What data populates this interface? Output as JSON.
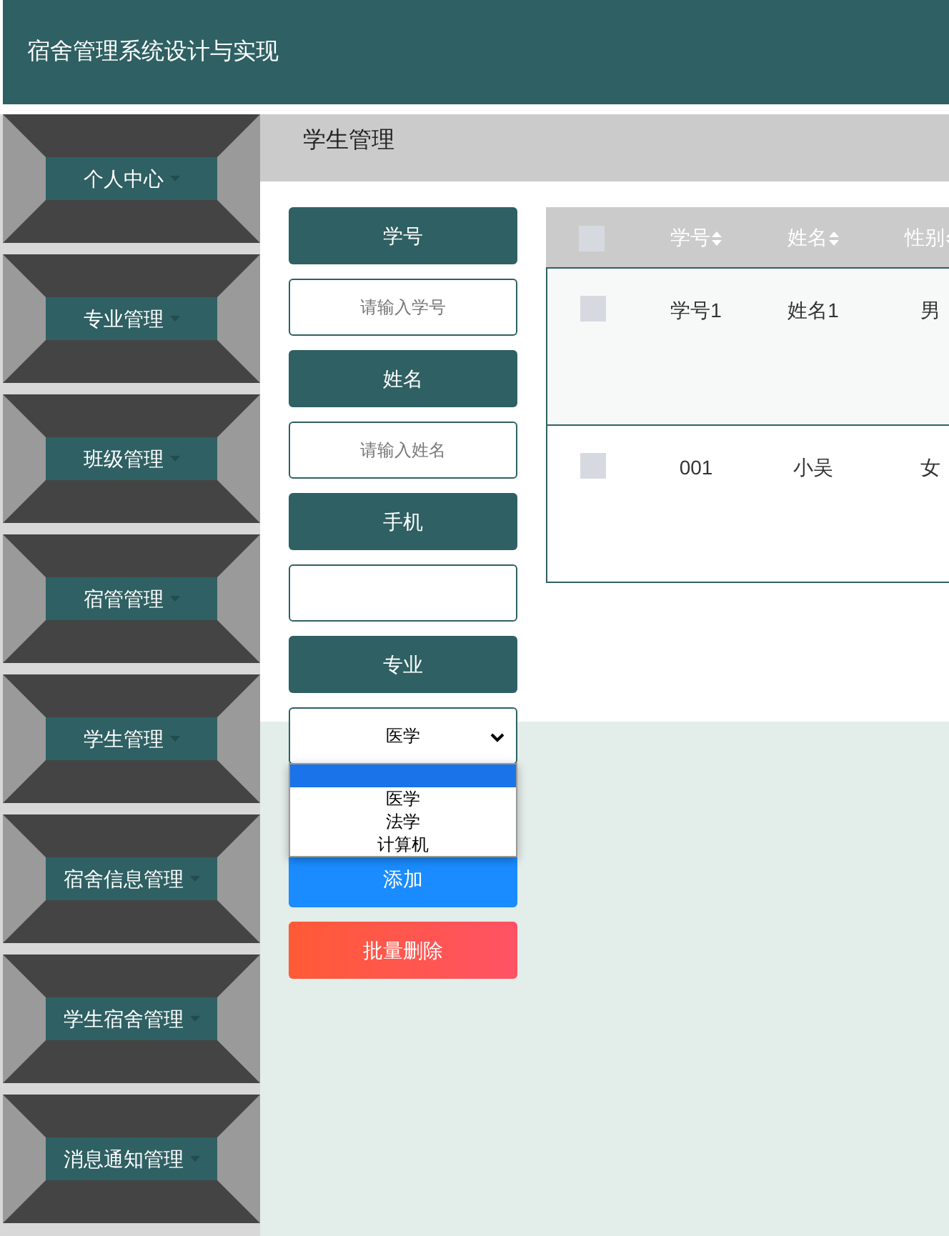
{
  "header": {
    "title": "宿舍管理系统设计与实现"
  },
  "sidebar": {
    "items": [
      {
        "label": "个人中心"
      },
      {
        "label": "专业管理"
      },
      {
        "label": "班级管理"
      },
      {
        "label": "宿管管理"
      },
      {
        "label": "学生管理"
      },
      {
        "label": "宿舍信息管理"
      },
      {
        "label": "学生宿舍管理"
      },
      {
        "label": "消息通知管理"
      }
    ]
  },
  "page_title": "学生管理",
  "form": {
    "fields": [
      {
        "label": "学号",
        "kind": "input",
        "placeholder": "请输入学号"
      },
      {
        "label": "姓名",
        "kind": "input",
        "placeholder": "请输入姓名"
      },
      {
        "label": "手机",
        "kind": "input"
      },
      {
        "label": "专业",
        "kind": "select",
        "value": "医学",
        "options": [
          {
            "highlighted": true
          },
          {
            "label": "医学",
            "highlighted": false
          },
          {
            "label": "法学",
            "highlighted": false
          },
          {
            "label": "计算机",
            "highlighted": false
          }
        ]
      }
    ],
    "buttons": [
      {
        "label": "添加",
        "kind": "primary"
      },
      {
        "label": "批量删除",
        "kind": "danger"
      }
    ]
  },
  "table": {
    "all_checked": false,
    "columns": [
      "学号",
      "姓名",
      "性别"
    ],
    "rows": [
      {
        "checked": false,
        "cells": [
          "学号1",
          "姓名1",
          "男"
        ]
      },
      {
        "checked": false,
        "cells": [
          "001",
          "小吴",
          "女"
        ]
      }
    ]
  }
}
